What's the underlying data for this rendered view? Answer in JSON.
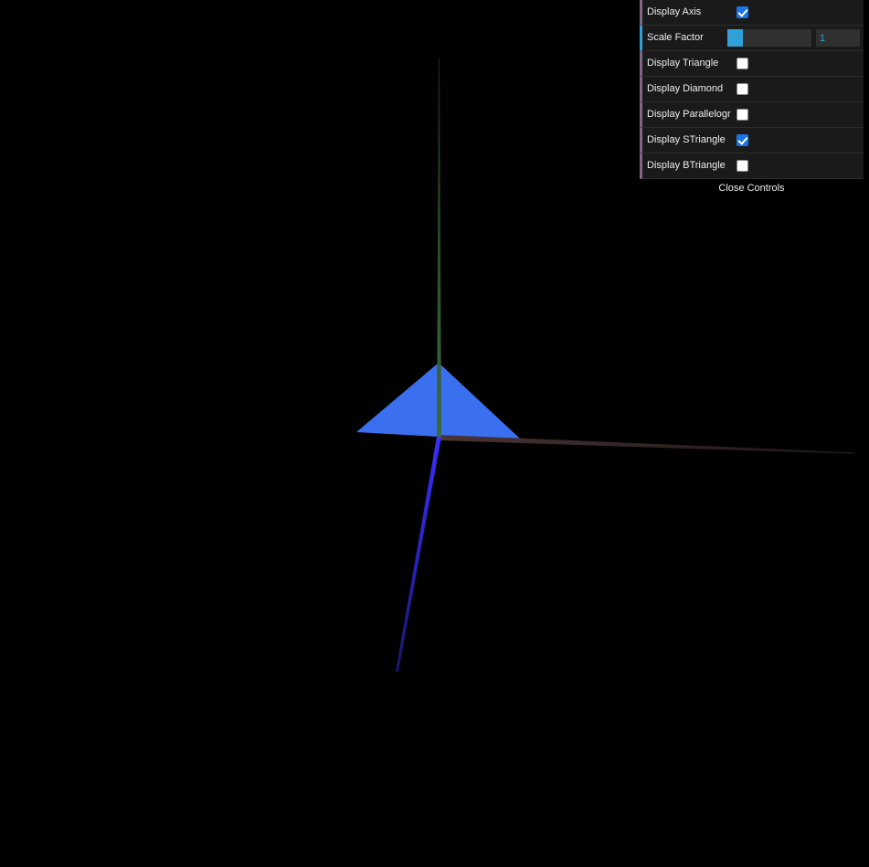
{
  "scene": {
    "background": "#000000",
    "shape_color": "#3a6ff0",
    "y_axis_color": "#3c6b3c",
    "x_axis_color": "#4a3434",
    "z_axis_color": "#2a22ee"
  },
  "controls": {
    "accent_color": "#2fa1d6",
    "items": [
      {
        "label": "Display Axis",
        "type": "checkbox",
        "checked": true
      },
      {
        "label": "Scale Factor",
        "type": "number",
        "value": "1",
        "fill_fraction": 0.18
      },
      {
        "label": "Display Triangle",
        "type": "checkbox",
        "checked": false
      },
      {
        "label": "Display Diamond",
        "type": "checkbox",
        "checked": false
      },
      {
        "label": "Display Parallelogr",
        "type": "checkbox",
        "checked": false
      },
      {
        "label": "Display STriangle",
        "type": "checkbox",
        "checked": true
      },
      {
        "label": "Display BTriangle",
        "type": "checkbox",
        "checked": false
      }
    ],
    "close_label": "Close Controls"
  }
}
